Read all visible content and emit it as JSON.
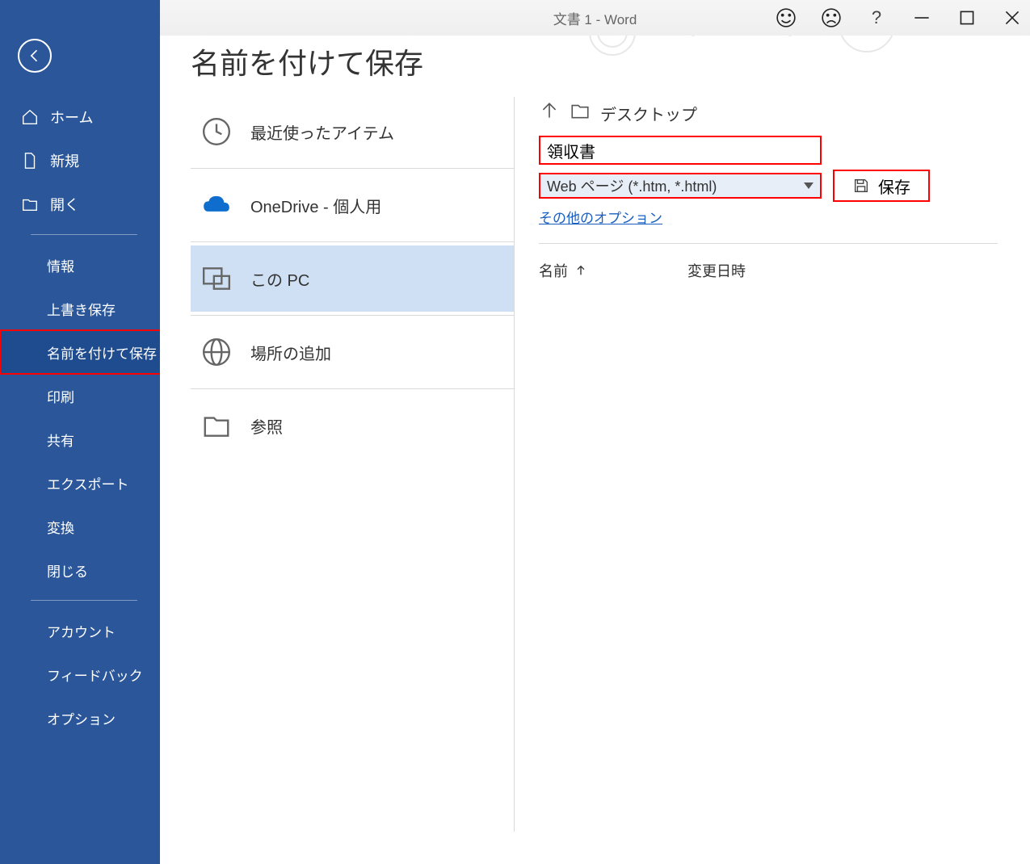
{
  "titlebar": {
    "text": "文書 1  -  Word"
  },
  "sidebar": {
    "items": [
      {
        "label": "ホーム"
      },
      {
        "label": "新規"
      },
      {
        "label": "開く"
      },
      {
        "label": "情報"
      },
      {
        "label": "上書き保存"
      },
      {
        "label": "名前を付けて保存"
      },
      {
        "label": "印刷"
      },
      {
        "label": "共有"
      },
      {
        "label": "エクスポート"
      },
      {
        "label": "変換"
      },
      {
        "label": "閉じる"
      },
      {
        "label": "アカウント"
      },
      {
        "label": "フィードバック"
      },
      {
        "label": "オプション"
      }
    ]
  },
  "page": {
    "title": "名前を付けて保存"
  },
  "locations": {
    "recent": "最近使ったアイテム",
    "onedrive": "OneDrive - 個人用",
    "this_pc": "この PC",
    "add_place": "場所の追加",
    "browse": "参照"
  },
  "right": {
    "path_label": "デスクトップ",
    "filename": "領収書",
    "format": "Web ページ (*.htm, *.html)",
    "save_label": "保存",
    "more_options": "その他のオプション",
    "headers": {
      "name": "名前",
      "modified": "変更日時"
    }
  },
  "help": "?"
}
